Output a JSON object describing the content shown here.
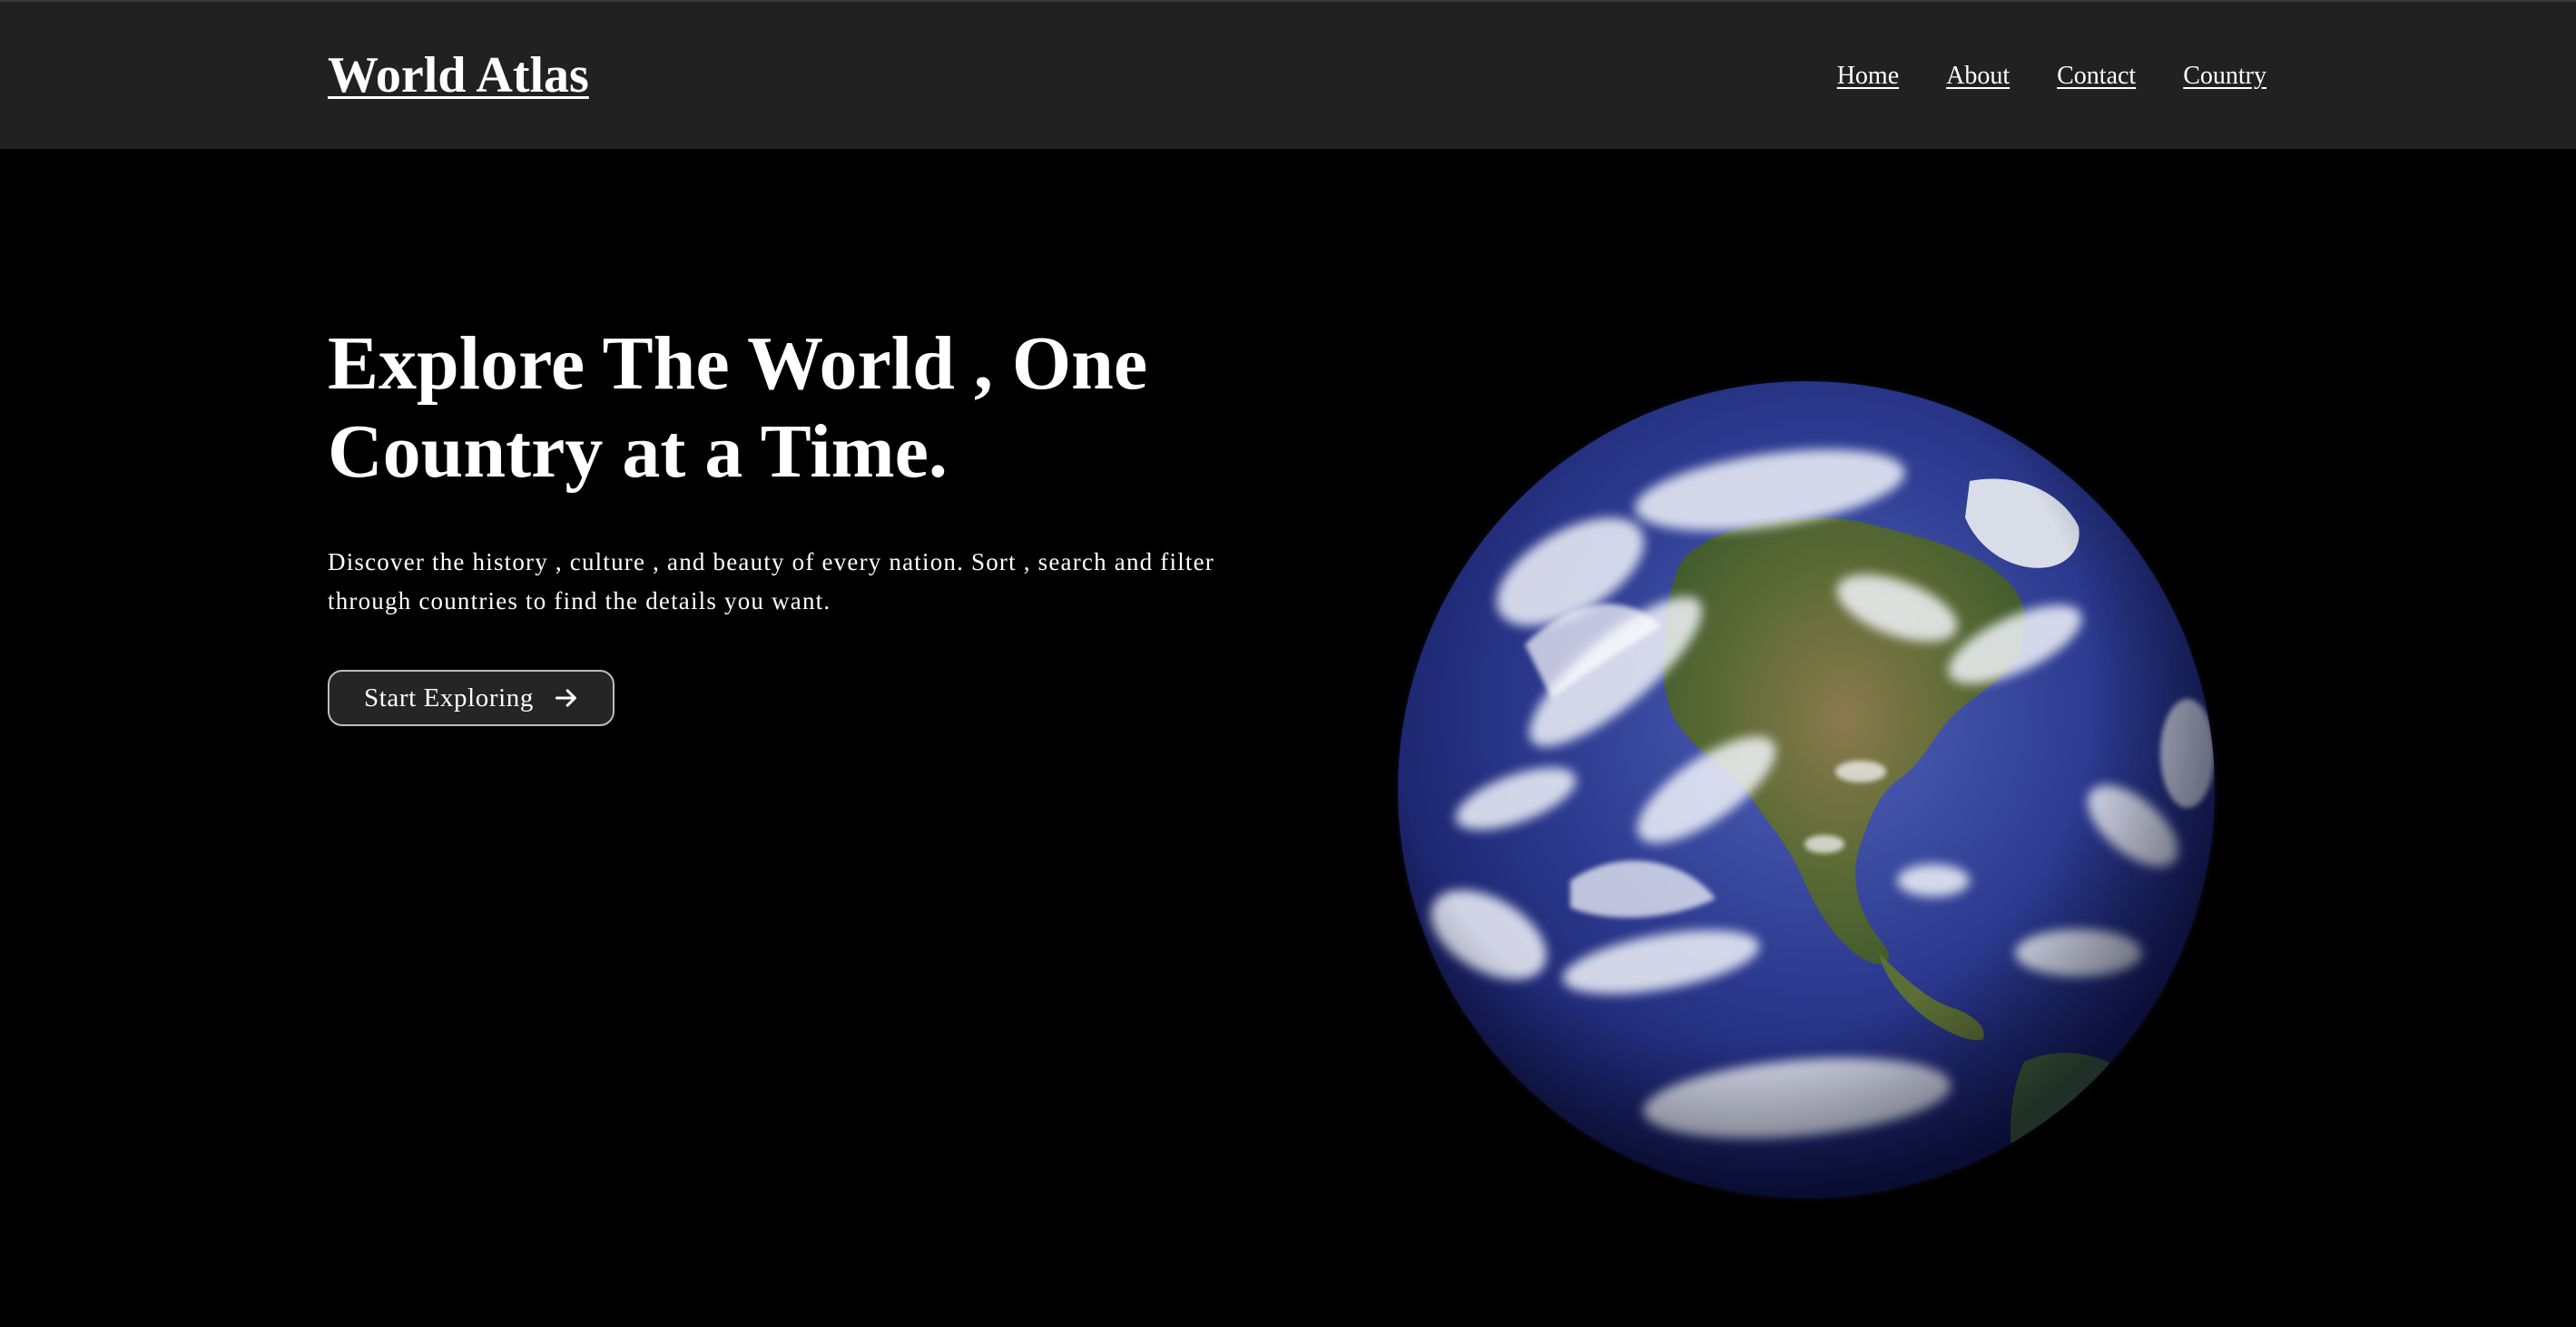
{
  "header": {
    "logo": "World Atlas",
    "nav": {
      "home": "Home",
      "about": "About",
      "contact": "Contact",
      "country": "Country"
    }
  },
  "hero": {
    "title": "Explore The World , One Country at a Time.",
    "description": "Discover the history , culture , and beauty of every nation. Sort , search and filter through countries to find the details you want.",
    "cta_label": "Start Exploring",
    "cta_icon": "arrow-right-icon",
    "image": "earth-globe-image"
  },
  "colors": {
    "background": "#000000",
    "header": "#212121",
    "text": "#ffffff",
    "button_border": "#bdbdbd"
  }
}
